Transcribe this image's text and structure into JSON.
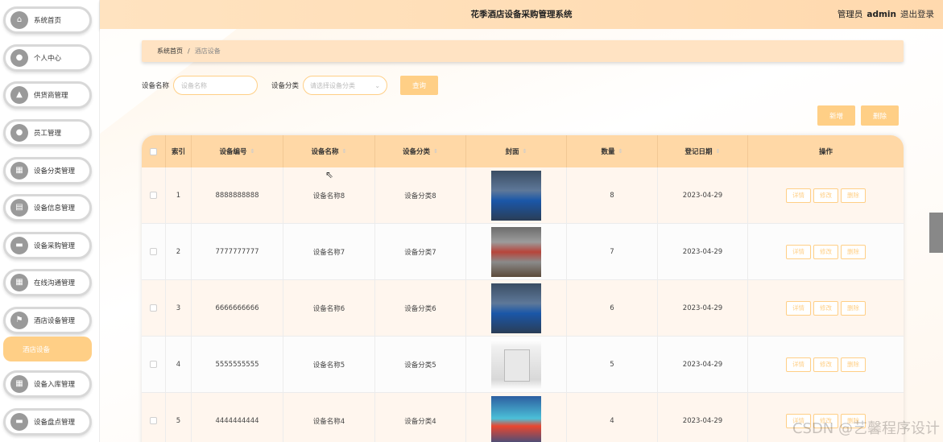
{
  "header": {
    "title": "花季酒店设备采购管理系统",
    "role": "管理员",
    "username": "admin",
    "logout": "退出登录"
  },
  "sidebar": {
    "items": [
      {
        "label": "系统首页",
        "icon": "home-icon"
      },
      {
        "label": "个人中心",
        "icon": "user-icon"
      },
      {
        "label": "供货商管理",
        "icon": "thumbs-up-icon"
      },
      {
        "label": "员工管理",
        "icon": "person-icon"
      },
      {
        "label": "设备分类管理",
        "icon": "grid-icon"
      },
      {
        "label": "设备信息管理",
        "icon": "document-icon"
      },
      {
        "label": "设备采购管理",
        "icon": "chat-icon"
      },
      {
        "label": "在线沟通管理",
        "icon": "grid-icon"
      },
      {
        "label": "酒店设备管理",
        "icon": "flag-icon"
      },
      {
        "label": "设备入库管理",
        "icon": "calendar-icon"
      },
      {
        "label": "设备盘点管理",
        "icon": "chat-icon"
      }
    ],
    "active_subitem": "酒店设备"
  },
  "breadcrumb": {
    "home": "系统首页",
    "separator": "/",
    "current": "酒店设备"
  },
  "search": {
    "name_label": "设备名称",
    "name_placeholder": "设备名称",
    "category_label": "设备分类",
    "category_placeholder": "请选择设备分类",
    "query_button": "查询"
  },
  "actions": {
    "add": "新增",
    "delete": "删除"
  },
  "table": {
    "headers": {
      "index": "索引",
      "code": "设备编号",
      "name": "设备名称",
      "category": "设备分类",
      "cover": "封面",
      "quantity": "数量",
      "date": "登记日期",
      "operations": "操作"
    },
    "rows": [
      {
        "index": "1",
        "code": "8888888888",
        "name": "设备名称8",
        "category": "设备分类8",
        "cover": "machine1",
        "quantity": "8",
        "date": "2023-04-29"
      },
      {
        "index": "2",
        "code": "7777777777",
        "name": "设备名称7",
        "category": "设备分类7",
        "cover": "machine2",
        "quantity": "7",
        "date": "2023-04-29"
      },
      {
        "index": "3",
        "code": "6666666666",
        "name": "设备名称6",
        "category": "设备分类6",
        "cover": "machine1",
        "quantity": "6",
        "date": "2023-04-29"
      },
      {
        "index": "4",
        "code": "5555555555",
        "name": "设备名称5",
        "category": "设备分类5",
        "cover": "chamber",
        "quantity": "5",
        "date": "2023-04-29"
      },
      {
        "index": "5",
        "code": "4444444444",
        "name": "设备名称4",
        "category": "设备分类4",
        "cover": "machine3",
        "quantity": "4",
        "date": "2023-04-29"
      }
    ],
    "row_ops": {
      "detail": "详情",
      "edit": "修改",
      "delete": "删除"
    }
  },
  "watermark": "CSDN @艺馨程序设计",
  "colors": {
    "accent": "#ffcf86",
    "header_bg": "#ffe3c0",
    "table_header": "#ffd8a6"
  }
}
